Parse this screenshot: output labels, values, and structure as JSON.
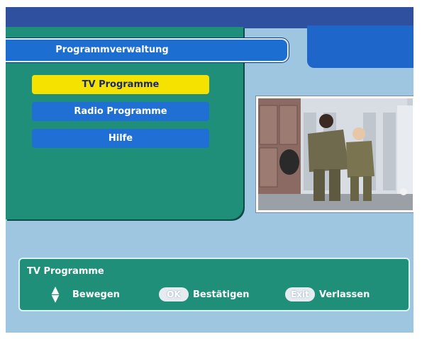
{
  "menu": {
    "title": "Programmverwaltung",
    "items": [
      {
        "label": "TV Programme",
        "selected": true
      },
      {
        "label": "Radio Programme",
        "selected": false
      },
      {
        "label": "Hilfe",
        "selected": false
      }
    ]
  },
  "info": {
    "title": "TV Programme",
    "hints": [
      {
        "icon": "up-down-arrows-icon",
        "label": "Bewegen"
      },
      {
        "key": "OK",
        "label": "Bestätigen"
      },
      {
        "key": "Exit",
        "label": "Verlassen"
      }
    ]
  },
  "colors": {
    "background": "#9fc6e1",
    "panel": "#1f8f79",
    "menu_item": "#1f6fd4",
    "highlight": "#f5e200",
    "topbar": "#2f4f9f"
  }
}
